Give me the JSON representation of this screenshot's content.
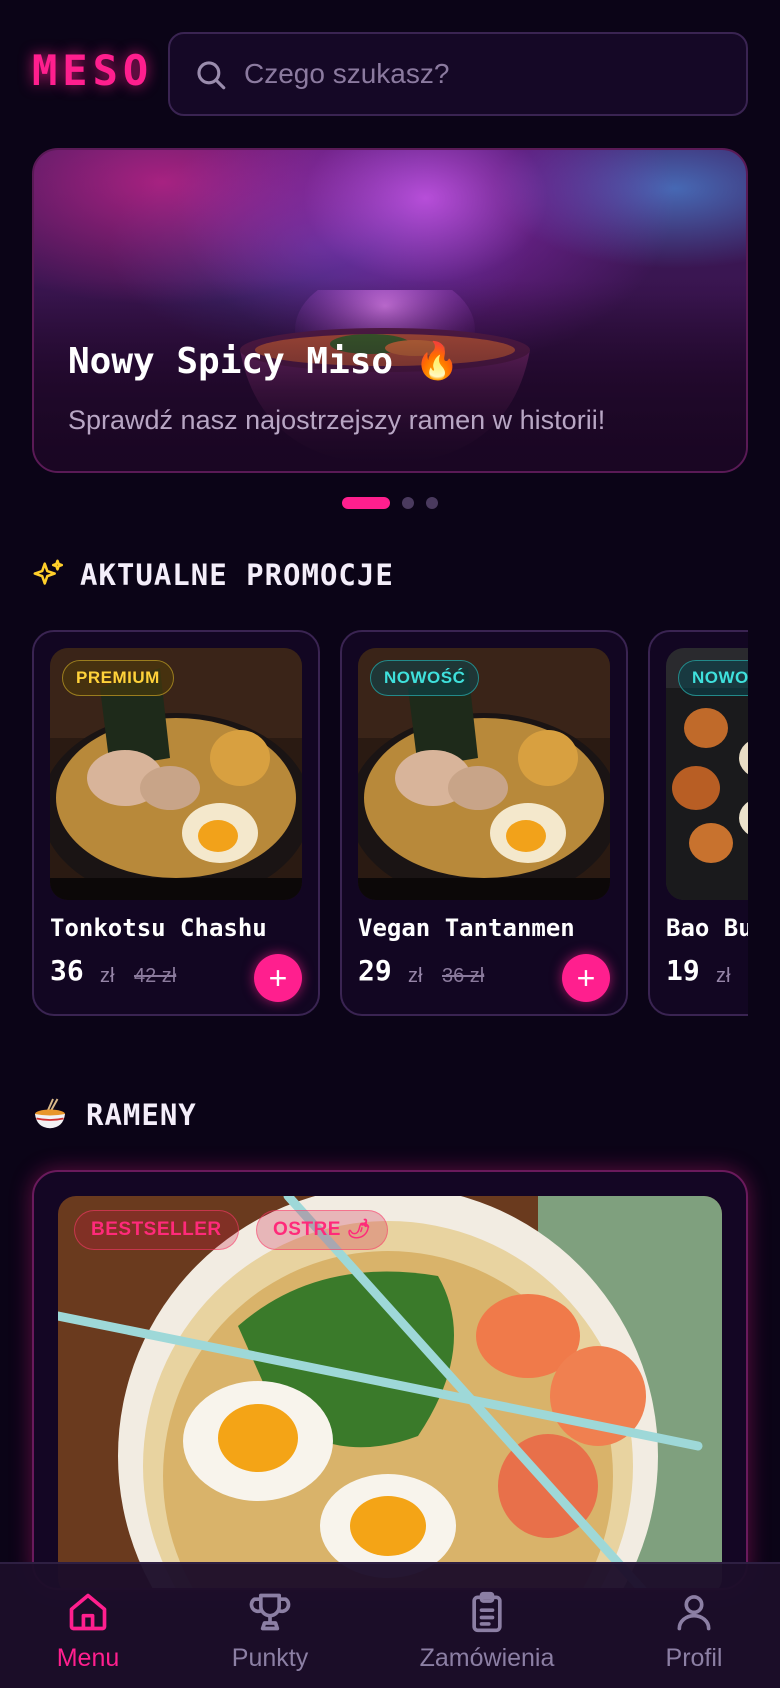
{
  "header": {
    "logo": "MESO",
    "search_placeholder": "Czego szukasz?"
  },
  "hero": {
    "title": "Nowy Spicy Miso 🔥",
    "subtitle": "Sprawdź nasz najostrzejszy ramen w historii!",
    "slides": 3,
    "active_slide": 1
  },
  "promotions": {
    "heading": "AKTUALNE PROMOCJE",
    "items": [
      {
        "badge": "PREMIUM",
        "name": "Tonkotsu Chashu",
        "price": "36",
        "currency": "zł",
        "old_price": "42 zł",
        "add": "+"
      },
      {
        "badge": "NOWOŚĆ",
        "name": "Vegan Tantanmen",
        "price": "29",
        "currency": "zł",
        "old_price": "36 zł",
        "add": "+"
      },
      {
        "badge": "NOWOŚĆ",
        "name": "Bao Bun",
        "price": "19",
        "currency": "zł",
        "old_price": "",
        "add": "+"
      }
    ]
  },
  "ramen": {
    "heading": "RAMENY",
    "featured": {
      "tags": [
        "BESTSELLER",
        "OSTRE 🌶"
      ]
    }
  },
  "nav": {
    "items": [
      {
        "label": "Menu",
        "icon": "home-icon",
        "active": true
      },
      {
        "label": "Punkty",
        "icon": "trophy-icon",
        "active": false
      },
      {
        "label": "Zamówienia",
        "icon": "clipboard-icon",
        "active": false
      },
      {
        "label": "Profil",
        "icon": "user-icon",
        "active": false
      }
    ]
  },
  "colors": {
    "accent": "#ff1f8e",
    "background": "#0b0417",
    "premium": "#ffd23a",
    "new": "#3fe0dc",
    "nav_inactive": "#8c7fa4"
  }
}
